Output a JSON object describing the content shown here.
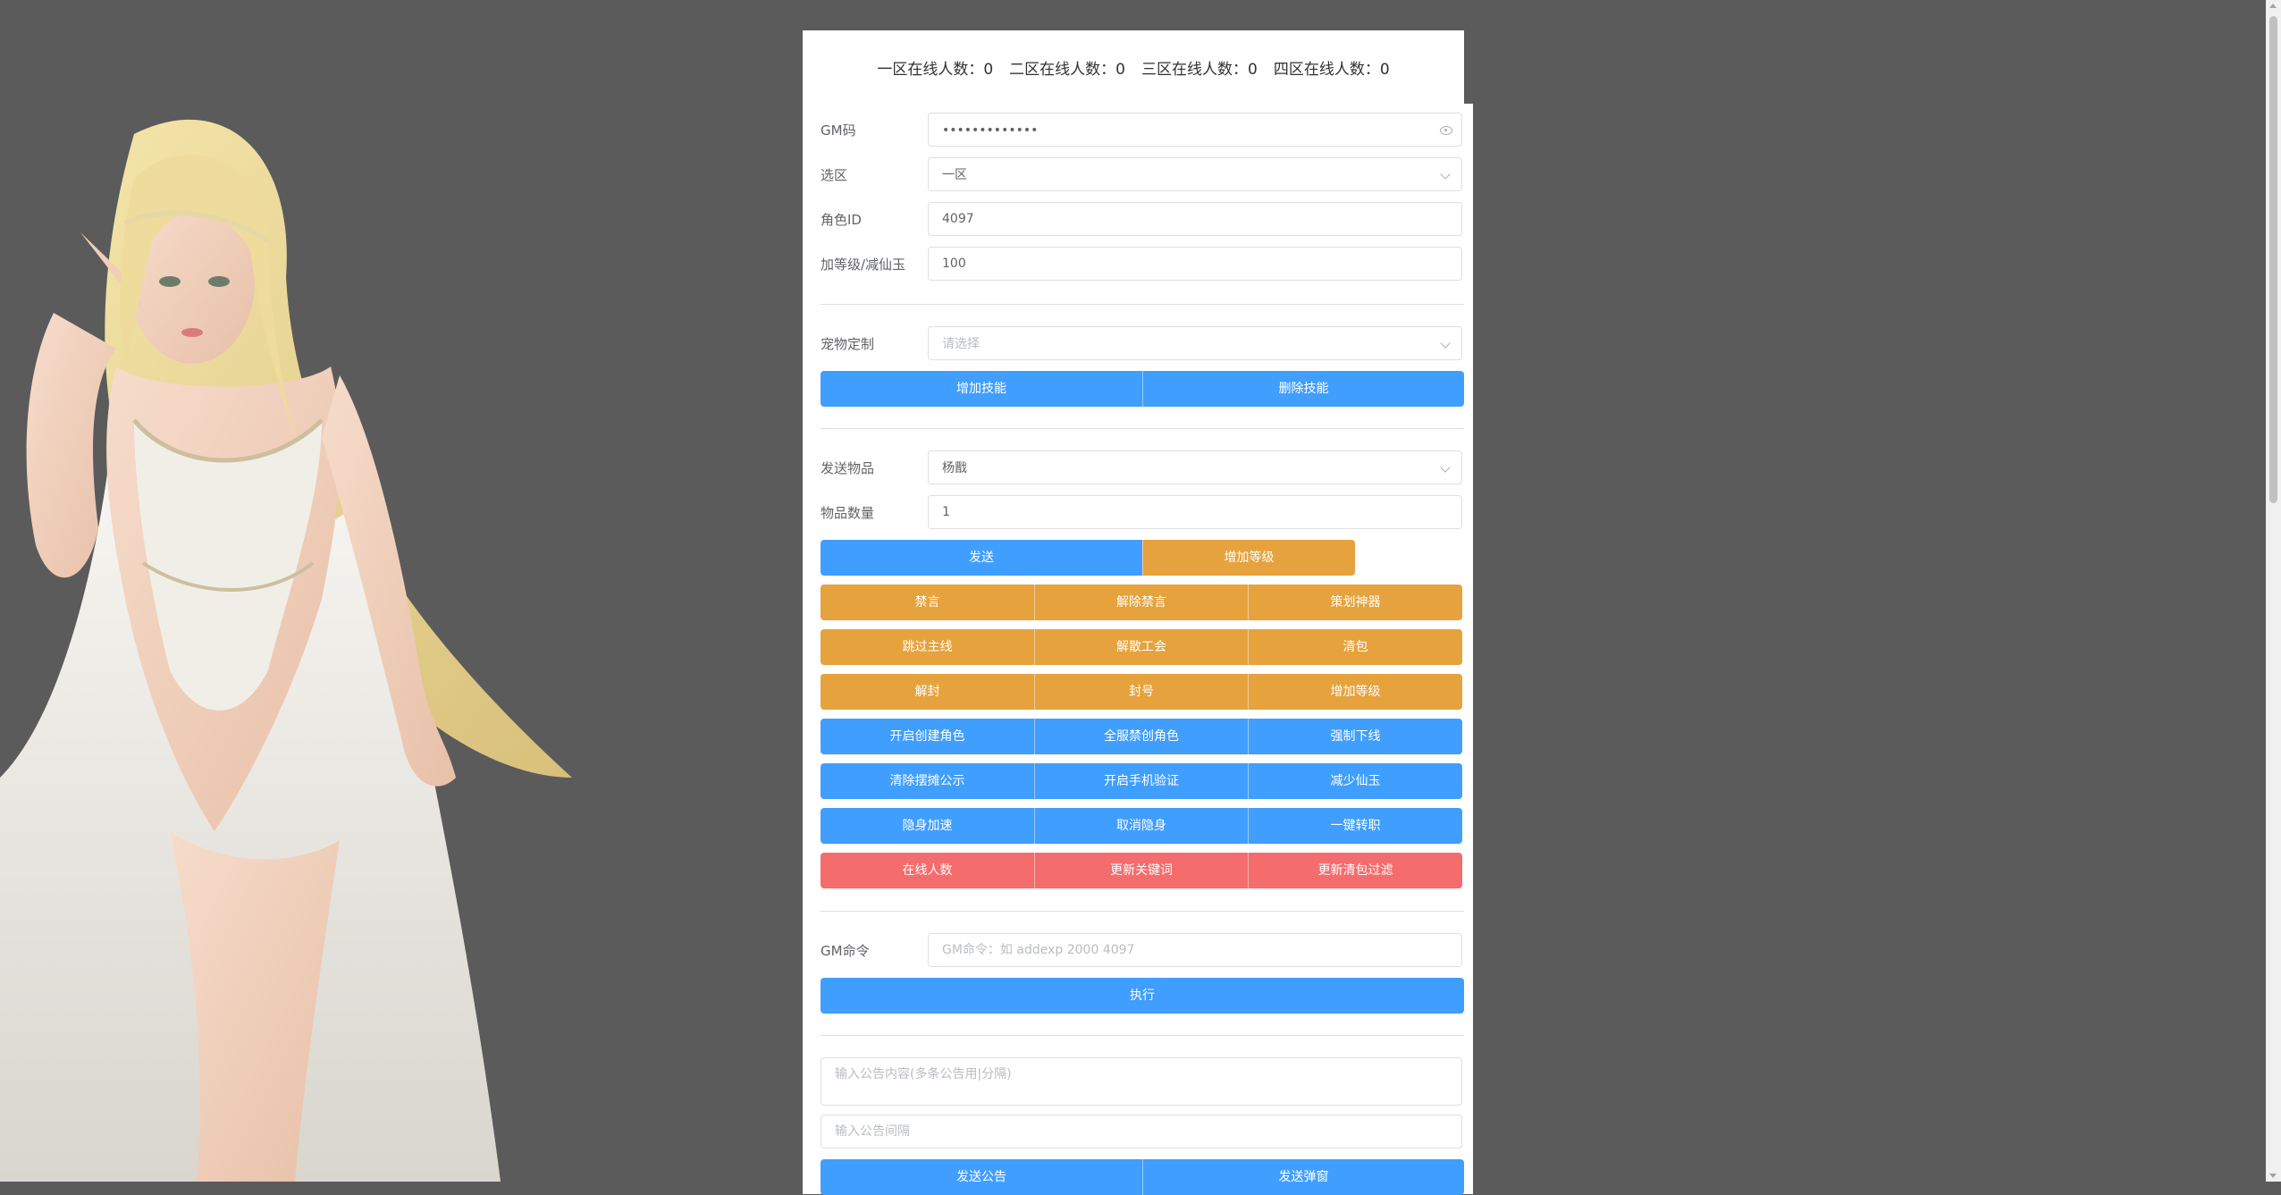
{
  "header": {
    "zones": [
      {
        "label": "一区在线人数：",
        "count": "0"
      },
      {
        "label": "二区在线人数：",
        "count": "0"
      },
      {
        "label": "三区在线人数：",
        "count": "0"
      },
      {
        "label": "四区在线人数：",
        "count": "0"
      }
    ]
  },
  "form": {
    "gm_code": {
      "label": "GM码",
      "value": "•••••••••••••"
    },
    "zone": {
      "label": "选区",
      "value": "一区"
    },
    "role_id": {
      "label": "角色ID",
      "value": "4097"
    },
    "level": {
      "label": "加等级/减仙玉",
      "value": "100"
    },
    "pet": {
      "label": "宠物定制",
      "placeholder": "请选择"
    },
    "send_item": {
      "label": "发送物品",
      "value": "杨戬"
    },
    "item_count": {
      "label": "物品数量",
      "value": "1"
    },
    "gm_command": {
      "label": "GM命令",
      "placeholder": "GM命令：如 addexp 2000 4097"
    },
    "announcement": {
      "placeholder": "输入公告内容(多条公告用|分隔)"
    },
    "interval": {
      "placeholder": "输入公告间隔"
    }
  },
  "buttons": {
    "add_skill": "增加技能",
    "delete_skill": "删除技能",
    "send": "发送",
    "add_level_1": "增加等级",
    "mute": "禁言",
    "unmute": "解除禁言",
    "plan_artifact": "策划神器",
    "skip_main": "跳过主线",
    "disband_guild": "解散工会",
    "clear_bag": "清包",
    "unban": "解封",
    "ban": "封号",
    "add_level_2": "增加等级",
    "open_create_role": "开启创建角色",
    "disable_create_role": "全服禁创角色",
    "force_offline": "强制下线",
    "clear_stall": "清除摆摊公示",
    "open_phone_verify": "开启手机验证",
    "reduce_jade": "减少仙玉",
    "stealth_speed": "隐身加速",
    "cancel_stealth": "取消隐身",
    "one_click_job": "一键转职",
    "online_count": "在线人数",
    "update_keywords": "更新关键词",
    "update_clear_filter": "更新清包过滤",
    "execute": "执行",
    "send_announcement": "发送公告",
    "send_barrage": "发送弹窗"
  },
  "colors": {
    "primary": "#409eff",
    "warning": "#e6a23c",
    "danger": "#f56c6c",
    "background": "#5b5b5b"
  }
}
